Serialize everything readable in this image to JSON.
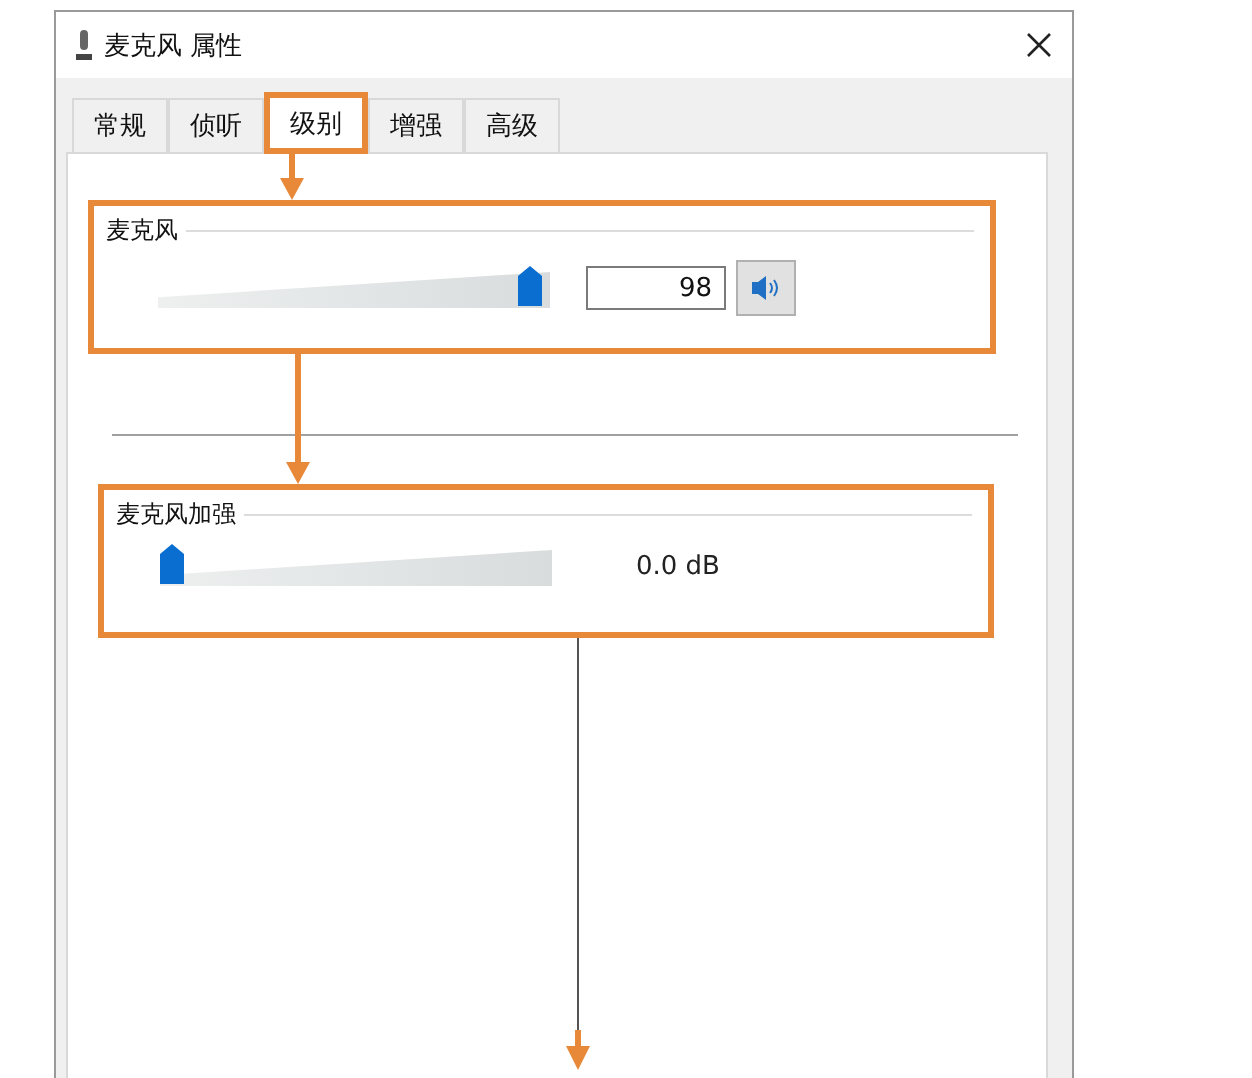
{
  "window": {
    "title": "麦克风 属性"
  },
  "tabs": [
    {
      "label": "常规",
      "selected": false,
      "highlighted": false
    },
    {
      "label": "侦听",
      "selected": false,
      "highlighted": false
    },
    {
      "label": "级别",
      "selected": true,
      "highlighted": true
    },
    {
      "label": "增强",
      "selected": false,
      "highlighted": false
    },
    {
      "label": "高级",
      "selected": false,
      "highlighted": false
    }
  ],
  "groups": [
    {
      "kind": "volume",
      "title": "麦克风",
      "level": 0.98,
      "value": "98",
      "muted": false,
      "highlighted": true
    },
    {
      "kind": "boost",
      "title": "麦克风加强",
      "level": 0,
      "reading": "0.0 dB",
      "highlighted": true
    }
  ]
}
